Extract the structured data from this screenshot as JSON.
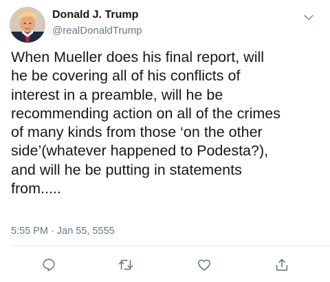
{
  "author": {
    "name": "Donald J. Trump",
    "handle": "@realDonaldTrump"
  },
  "tweet": {
    "lines": [
      "When Mueller does his final report, will",
      "he be covering all of his conflicts of",
      "interest in a preamble, will he be",
      "recommending action on all of the crimes",
      "of many kinds from those ‘on the other",
      "side’(whatever happened to Podesta?),",
      "and will he be putting in statements",
      "from....."
    ],
    "timestamp": "5:55 PM · Jan 55, 5555"
  },
  "icons": {
    "menu": "chevron-down-icon",
    "reply": "reply-icon",
    "retweet": "retweet-icon",
    "like": "heart-icon",
    "share": "share-icon"
  },
  "colors": {
    "text": "#14171a",
    "secondary": "#657786",
    "divider": "#e1e8ed"
  }
}
